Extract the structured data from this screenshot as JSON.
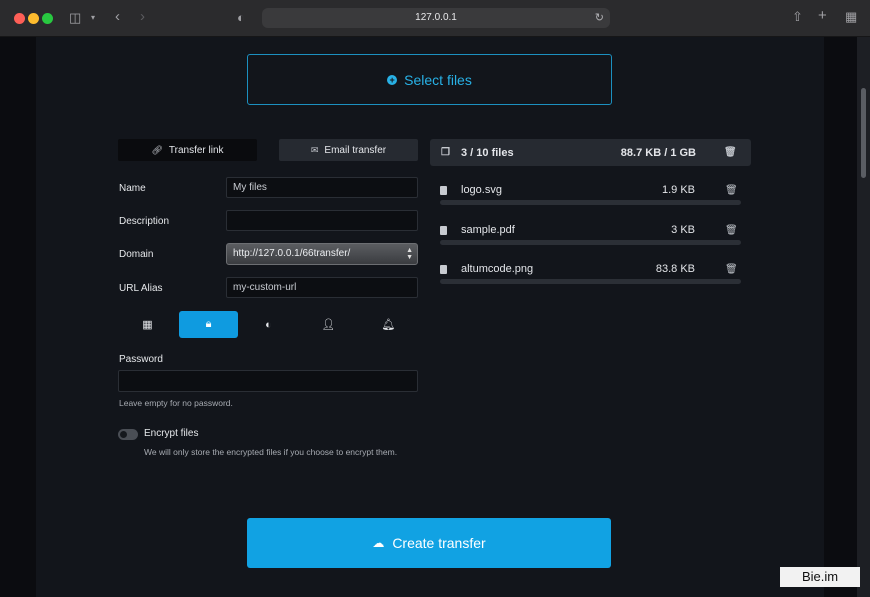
{
  "browser": {
    "url": "127.0.0.1"
  },
  "select_files": {
    "label": "Select files"
  },
  "tabs": [
    {
      "label": "Transfer link",
      "active": true,
      "icon": "link-icon"
    },
    {
      "label": "Email transfer",
      "active": false,
      "icon": "envelope-icon"
    }
  ],
  "form": {
    "name": {
      "label": "Name",
      "value": "My files"
    },
    "description": {
      "label": "Description",
      "value": ""
    },
    "domain": {
      "label": "Domain",
      "value": "http://127.0.0.1/66transfer/"
    },
    "url_alias": {
      "label": "URL Alias",
      "value": "my-custom-url"
    },
    "option_icons": [
      "calendar-icon",
      "lock-icon",
      "contrast-icon",
      "user-icon",
      "bell-icon"
    ],
    "active_option": "lock-icon",
    "password": {
      "label": "Password",
      "value": "",
      "hint": "Leave empty for no password."
    },
    "encrypt": {
      "label": "Encrypt files",
      "enabled": false,
      "hint": "We will only store the encrypted files if you choose to encrypt them."
    }
  },
  "files": {
    "count_label": "3 / 10 files",
    "size_label": "88.7 KB / 1 GB",
    "items": [
      {
        "name": "logo.svg",
        "size": "1.9 KB",
        "progress": 0
      },
      {
        "name": "sample.pdf",
        "size": "3 KB",
        "progress": 0
      },
      {
        "name": "altumcode.png",
        "size": "83.8 KB",
        "progress": 0
      }
    ]
  },
  "create_button": {
    "label": "Create transfer"
  },
  "watermark": "Bie.im",
  "colors": {
    "accent": "#11a2e3",
    "background": "#12151b",
    "panel": "#262a31"
  }
}
